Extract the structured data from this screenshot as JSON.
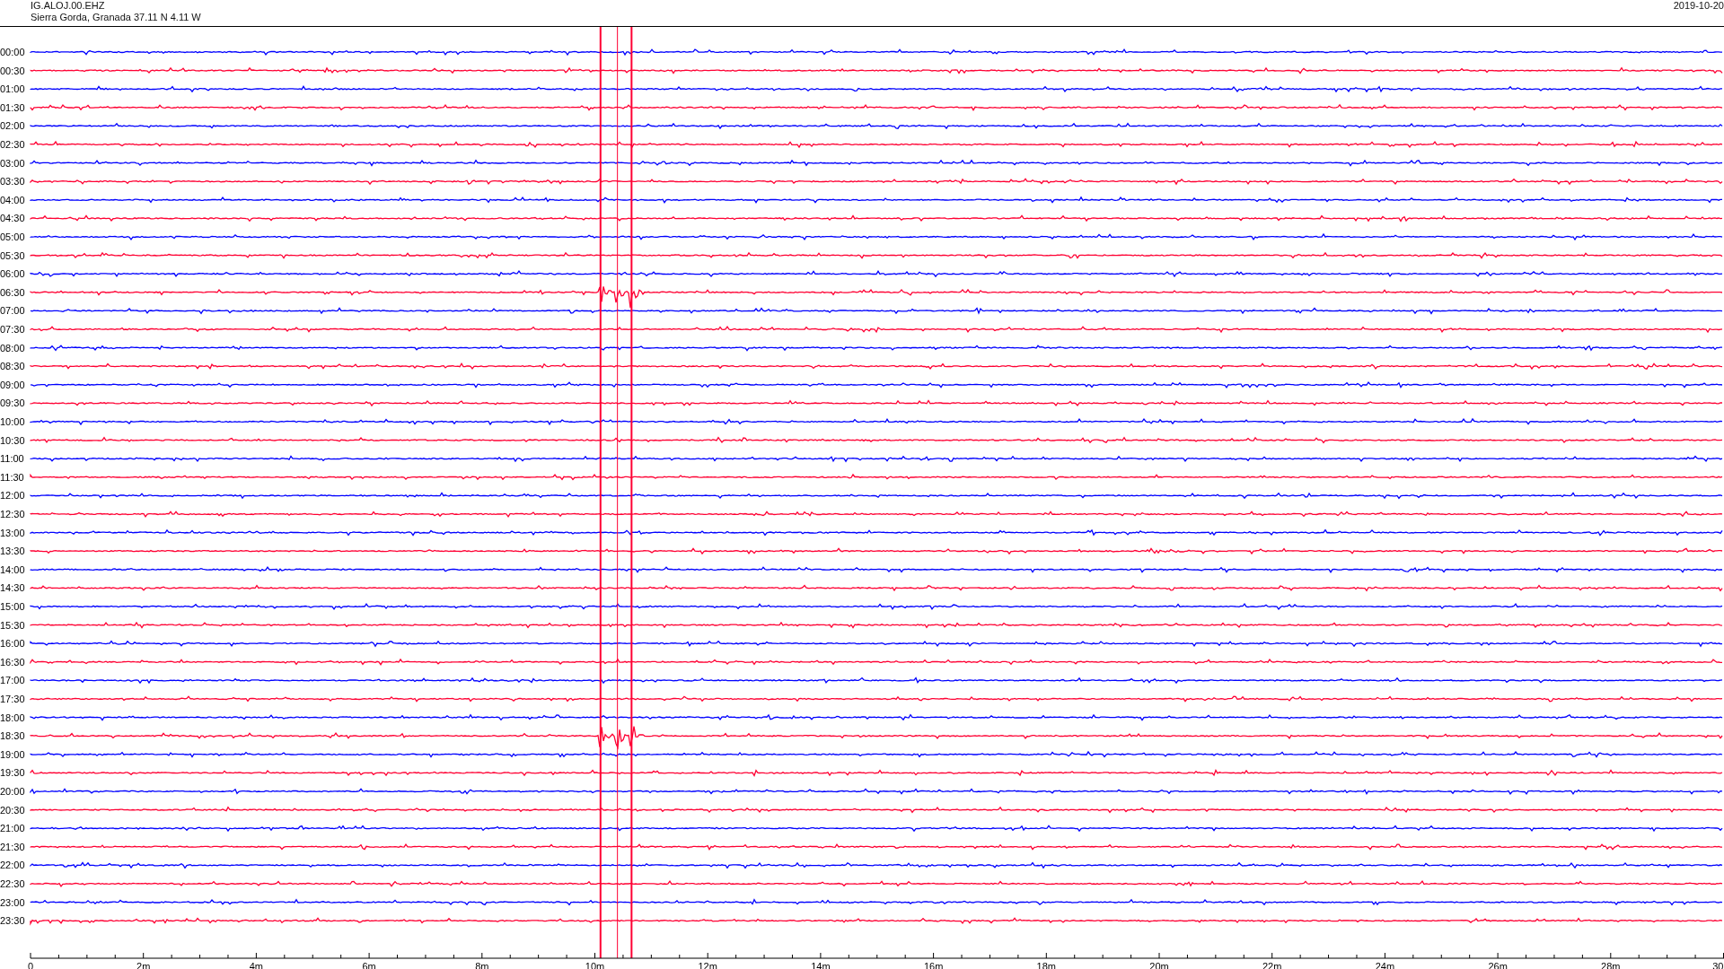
{
  "header": {
    "station": "IG.ALOJ.00.EHZ",
    "location": "Sierra Gorda, Granada  37.11 N 4.11 W",
    "date": "2019-10-20"
  },
  "rows": [
    {
      "label": "00:00",
      "color": "#0000ff"
    },
    {
      "label": "00:30",
      "color": "#ff0033"
    },
    {
      "label": "01:00",
      "color": "#0000ff"
    },
    {
      "label": "01:30",
      "color": "#ff0033"
    },
    {
      "label": "02:00",
      "color": "#0000ff"
    },
    {
      "label": "02:30",
      "color": "#ff0033"
    },
    {
      "label": "03:00",
      "color": "#0000ff"
    },
    {
      "label": "03:30",
      "color": "#ff0033"
    },
    {
      "label": "04:00",
      "color": "#0000ff"
    },
    {
      "label": "04:30",
      "color": "#ff0033"
    },
    {
      "label": "05:00",
      "color": "#0000ff"
    },
    {
      "label": "05:30",
      "color": "#ff0033"
    },
    {
      "label": "06:00",
      "color": "#0000ff"
    },
    {
      "label": "06:30",
      "color": "#ff0033"
    },
    {
      "label": "07:00",
      "color": "#0000ff"
    },
    {
      "label": "07:30",
      "color": "#ff0033"
    },
    {
      "label": "08:00",
      "color": "#0000ff"
    },
    {
      "label": "08:30",
      "color": "#ff0033"
    },
    {
      "label": "09:00",
      "color": "#0000ff"
    },
    {
      "label": "09:30",
      "color": "#ff0033"
    },
    {
      "label": "10:00",
      "color": "#0000ff"
    },
    {
      "label": "10:30",
      "color": "#ff0033"
    },
    {
      "label": "11:00",
      "color": "#0000ff"
    },
    {
      "label": "11:30",
      "color": "#ff0033"
    },
    {
      "label": "12:00",
      "color": "#0000ff"
    },
    {
      "label": "12:30",
      "color": "#ff0033"
    },
    {
      "label": "13:00",
      "color": "#0000ff"
    },
    {
      "label": "13:30",
      "color": "#ff0033"
    },
    {
      "label": "14:00",
      "color": "#0000ff"
    },
    {
      "label": "14:30",
      "color": "#ff0033"
    },
    {
      "label": "15:00",
      "color": "#0000ff"
    },
    {
      "label": "15:30",
      "color": "#ff0033"
    },
    {
      "label": "16:00",
      "color": "#0000ff"
    },
    {
      "label": "16:30",
      "color": "#ff0033"
    },
    {
      "label": "17:00",
      "color": "#0000ff"
    },
    {
      "label": "17:30",
      "color": "#ff0033"
    },
    {
      "label": "18:00",
      "color": "#0000ff"
    },
    {
      "label": "18:30",
      "color": "#ff0033"
    },
    {
      "label": "19:00",
      "color": "#0000ff"
    },
    {
      "label": "19:30",
      "color": "#ff0033"
    },
    {
      "label": "20:00",
      "color": "#0000ff"
    },
    {
      "label": "20:30",
      "color": "#ff0033"
    },
    {
      "label": "21:00",
      "color": "#0000ff"
    },
    {
      "label": "21:30",
      "color": "#ff0033"
    },
    {
      "label": "22:00",
      "color": "#0000ff"
    },
    {
      "label": "22:30",
      "color": "#ff0033"
    },
    {
      "label": "23:00",
      "color": "#0000ff"
    },
    {
      "label": "23:30",
      "color": "#ff0033"
    }
  ],
  "x_axis": [
    "0",
    "2m",
    "4m",
    "6m",
    "8m",
    "10m",
    "12m",
    "14m",
    "16m",
    "18m",
    "20m",
    "22m",
    "24m",
    "26m",
    "28m",
    "30"
  ]
}
